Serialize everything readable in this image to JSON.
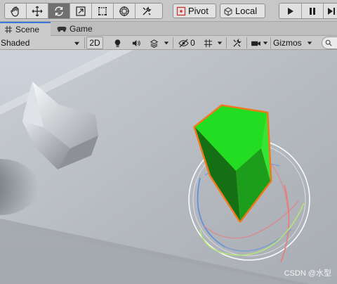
{
  "toolbar": {
    "pivot_label": "Pivot",
    "local_label": "Local"
  },
  "tabs": [
    {
      "label": "Scene"
    },
    {
      "label": "Game"
    }
  ],
  "scene_bar": {
    "shading_mode": "Shaded",
    "mode_2d": "2D",
    "hidden_count": "0",
    "gizmos_label": "Gizmos",
    "search_placeholder": ""
  },
  "watermark": "CSDN @水型",
  "colors": {
    "selection_outline": "#f07a1a",
    "cube_face": "#22dd22",
    "cube_shadow_face": "#157015",
    "gizmo_x": "#e87a7a",
    "gizmo_y": "#b5e27a",
    "gizmo_z": "#5a8fe0",
    "tab_accent": "#3a79d7"
  }
}
